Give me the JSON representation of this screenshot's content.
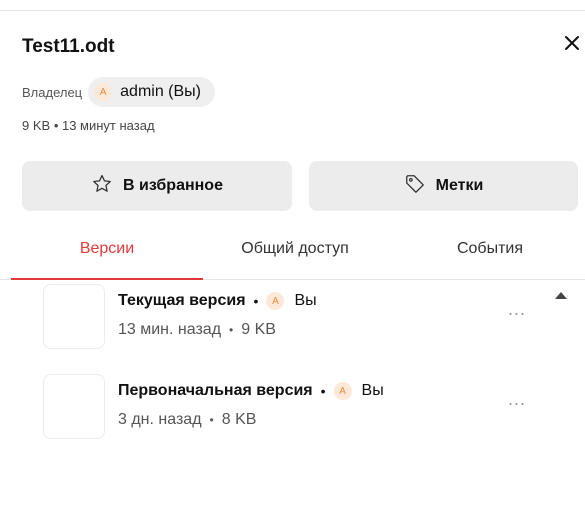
{
  "file": {
    "title": "Test11.odt",
    "owner_label": "Владелец",
    "owner_initial": "A",
    "owner_name": "admin (Вы)",
    "size": "9 KB",
    "modified": "13 минут назад"
  },
  "actions": {
    "favorite_label": "В избранное",
    "tags_label": "Метки"
  },
  "tabs": [
    {
      "label": "Версии",
      "active": true
    },
    {
      "label": "Общий доступ",
      "active": false
    },
    {
      "label": "События",
      "active": false
    }
  ],
  "versions": [
    {
      "name": "Текущая версия",
      "user_initial": "A",
      "user": "Вы",
      "time": "13 мин. назад",
      "size": "9 KB",
      "more": "..."
    },
    {
      "name": "Первоначальная версия",
      "user_initial": "A",
      "user": "Вы",
      "time": "3 дн. назад",
      "size": "8 KB",
      "more": "..."
    }
  ],
  "colors": {
    "accent": "#e03a3a",
    "avatar_bg": "#fde9d9",
    "avatar_fg": "#ef8a3c",
    "button_bg": "#ececec"
  },
  "icons": {
    "close": "close-icon",
    "favorite": "star-icon",
    "tags": "tag-icon",
    "scroll": "scroll-up-arrow-icon"
  }
}
